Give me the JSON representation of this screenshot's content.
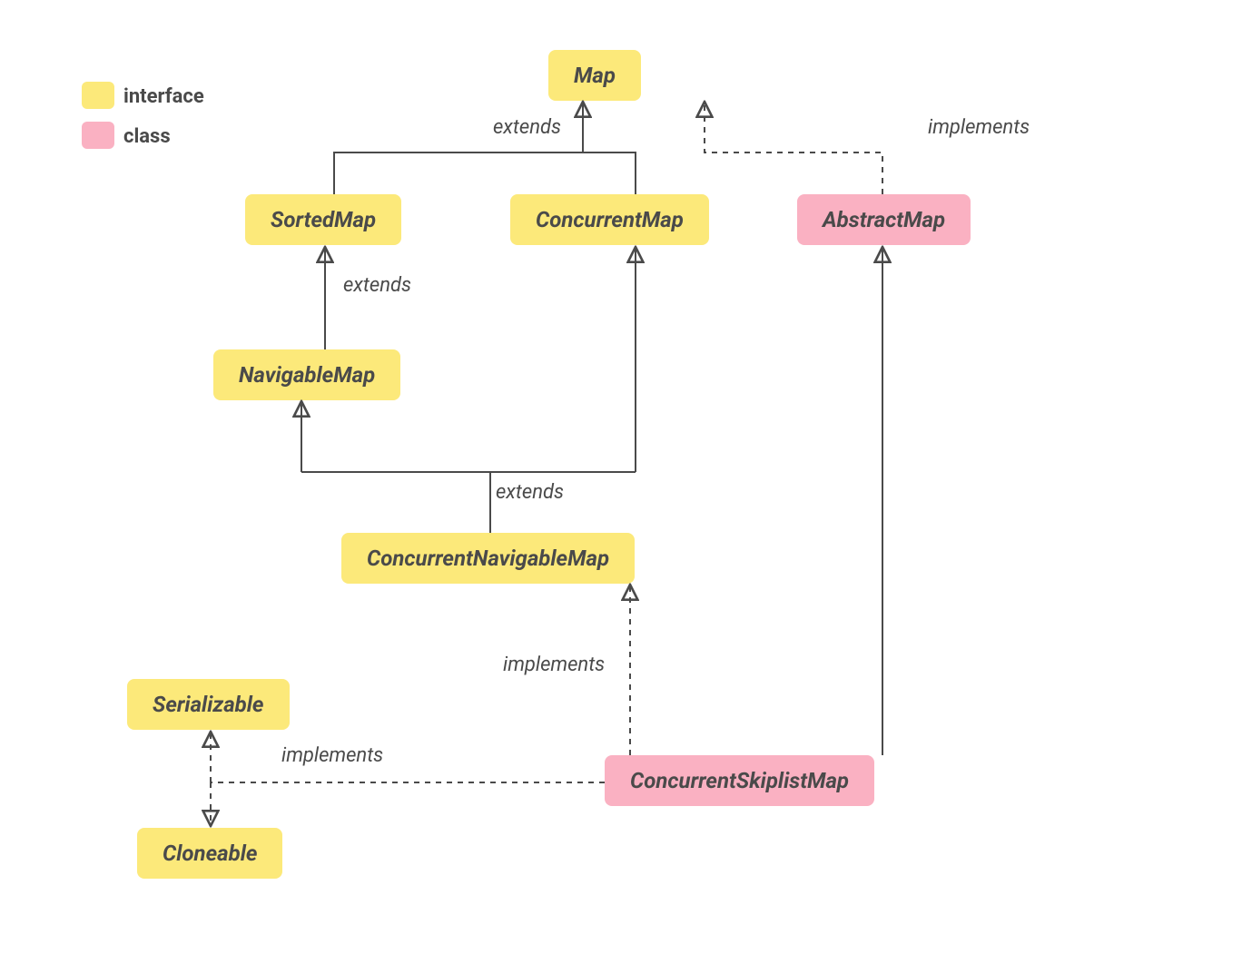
{
  "legend": {
    "interface": "interface",
    "class": "class"
  },
  "nodes": {
    "map": "Map",
    "sortedMap": "SortedMap",
    "concurrentMap": "ConcurrentMap",
    "abstractMap": "AbstractMap",
    "navigableMap": "NavigableMap",
    "concurrentNavigableMap": "ConcurrentNavigableMap",
    "serializable": "Serializable",
    "cloneable": "Cloneable",
    "concurrentSkiplistMap": "ConcurrentSkiplistMap"
  },
  "edges": {
    "extends": "extends",
    "implements": "implements"
  },
  "colors": {
    "interface": "#fce97a",
    "class": "#fab1c2",
    "text": "#4a4a4a",
    "line": "#4a4a4a"
  }
}
